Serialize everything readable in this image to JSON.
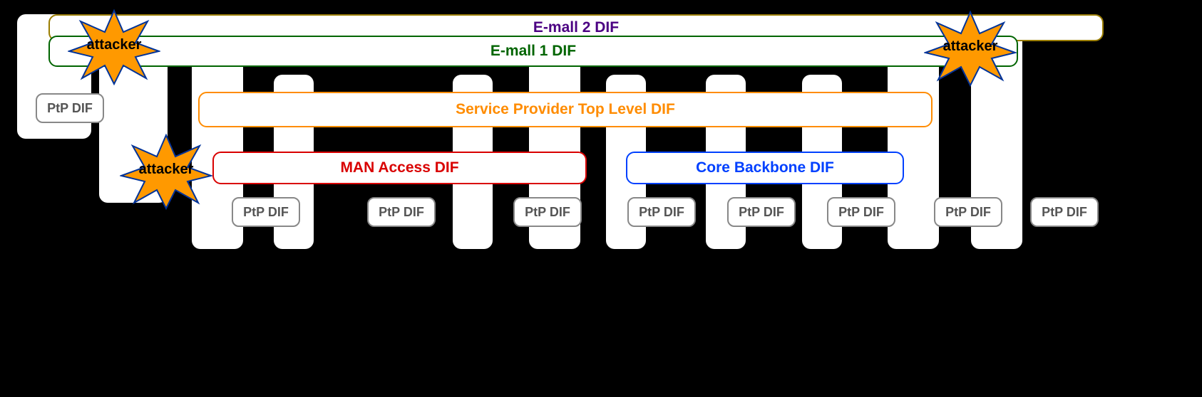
{
  "diagram": {
    "ptp_label": "PtP DIF",
    "layers": {
      "email2": {
        "label": "E-mall 2 DIF",
        "color": "#4B0082",
        "border": "#9A7D00"
      },
      "email1": {
        "label": "E-mall 1 DIF",
        "color": "#006400",
        "border": "#006400"
      },
      "sp_top": {
        "label": "Service Provider Top Level DIF",
        "color": "#FF8C00",
        "border": "#FF8C00"
      },
      "man_access": {
        "label": "MAN Access  DIF",
        "color": "#D90000",
        "border": "#D90000"
      },
      "core_backbone": {
        "label": "Core  Backbone DIF",
        "color": "#0040FF",
        "border": "#0040FF"
      }
    },
    "attacker_label": "attacker",
    "attacker_fill": "#FF9900",
    "attacker_stroke": "#003399"
  }
}
